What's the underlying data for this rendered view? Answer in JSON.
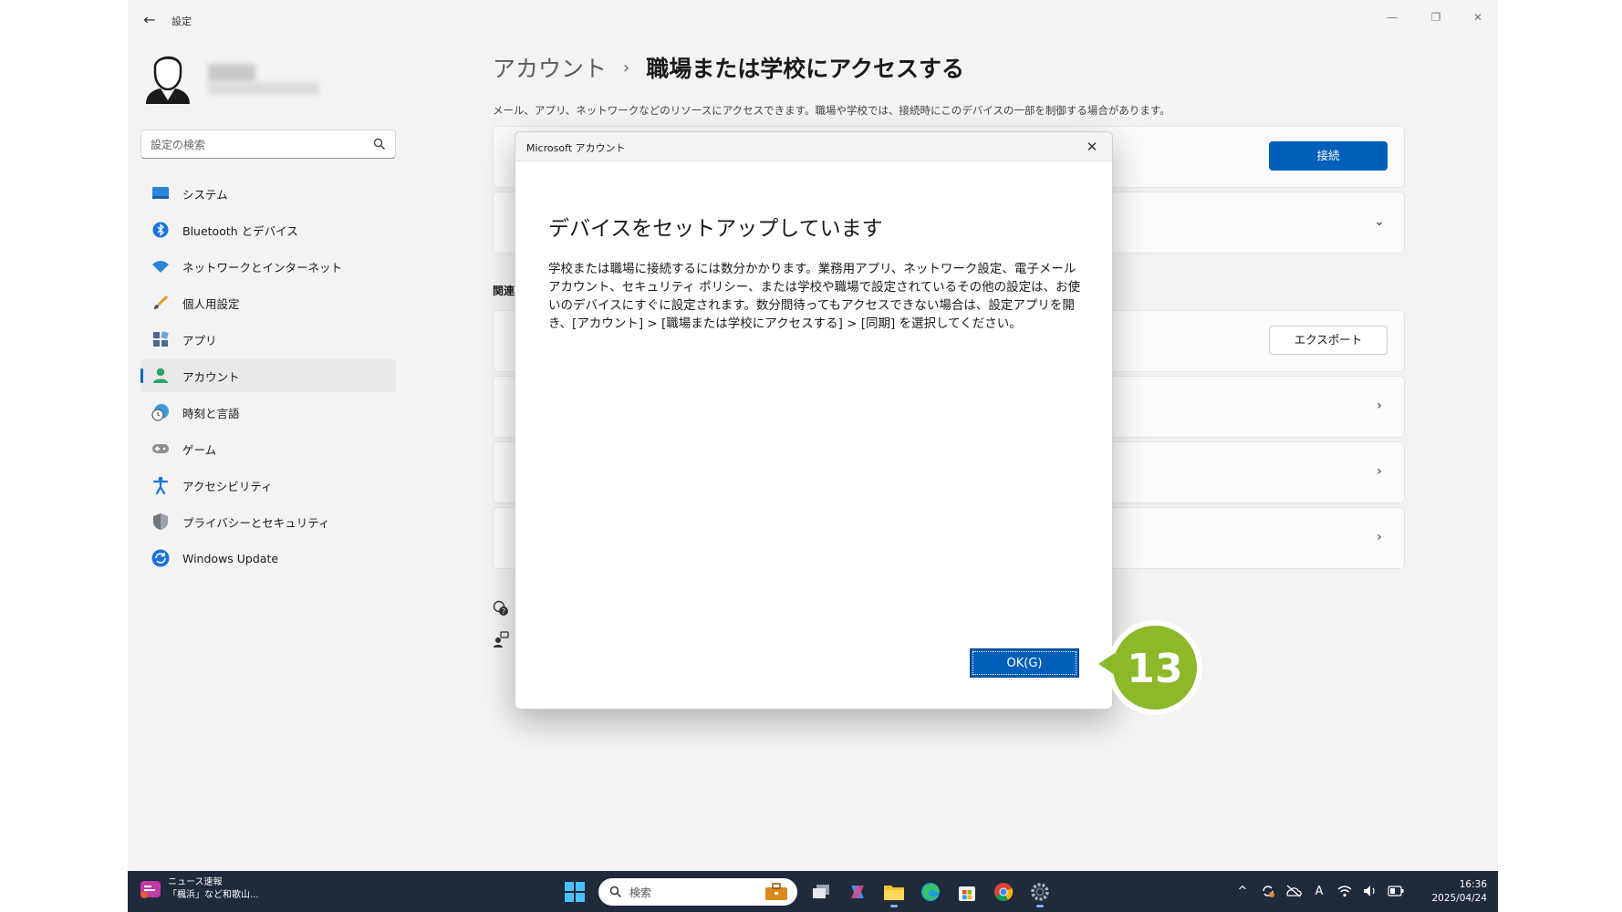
{
  "window": {
    "app_title": "設定",
    "controls": [
      "minimize",
      "restore",
      "close"
    ]
  },
  "search": {
    "placeholder": "設定の検索"
  },
  "nav": [
    {
      "label": "システム",
      "icon": "system-icon"
    },
    {
      "label": "Bluetooth とデバイス",
      "icon": "bluetooth-icon"
    },
    {
      "label": "ネットワークとインターネット",
      "icon": "wifi-icon"
    },
    {
      "label": "個人用設定",
      "icon": "brush-icon"
    },
    {
      "label": "アプリ",
      "icon": "apps-icon"
    },
    {
      "label": "アカウント",
      "icon": "account-icon",
      "selected": true
    },
    {
      "label": "時刻と言語",
      "icon": "clock-globe-icon"
    },
    {
      "label": "ゲーム",
      "icon": "gamepad-icon"
    },
    {
      "label": "アクセシビリティ",
      "icon": "accessibility-icon"
    },
    {
      "label": "プライバシーとセキュリティ",
      "icon": "shield-icon"
    },
    {
      "label": "Windows Update",
      "icon": "update-icon"
    }
  ],
  "main": {
    "breadcrumb_parent": "アカウント",
    "breadcrumb_separator": "›",
    "page_title": "職場または学校にアクセスする",
    "description": "メール、アプリ、ネットワークなどのリソースにアクセスできます。職場や学校では、接続時にこのデバイスの一部を制御する場合があります。",
    "connect_button": "接続",
    "section_label": "関連",
    "export_button": "エクスポート"
  },
  "dialog": {
    "title": "Microsoft アカウント",
    "heading": "デバイスをセットアップしています",
    "body": "学校または職場に接続するには数分かかります。業務用アプリ、ネットワーク設定、電子メール アカウント、セキュリティ ポリシー、または学校や職場で設定されているその他の設定は、お使いのデバイスにすぐに設定されます。数分間待ってもアクセスできない場合は、設定アプリを開き、[アカウント] > [職場または学校にアクセスする] > [同期] を選択してください。",
    "ok_button": "OK(G)"
  },
  "callout": {
    "step": "13",
    "color": "#8cb82a"
  },
  "taskbar": {
    "news_title": "ニュース速報",
    "news_subtitle": "「楓浜」など和歌山...",
    "search_placeholder": "検索",
    "time": "16:36",
    "date": "2025/04/24",
    "ime": "A"
  },
  "colors": {
    "accent": "#005fb8",
    "taskbar": "#1f2a3a"
  }
}
